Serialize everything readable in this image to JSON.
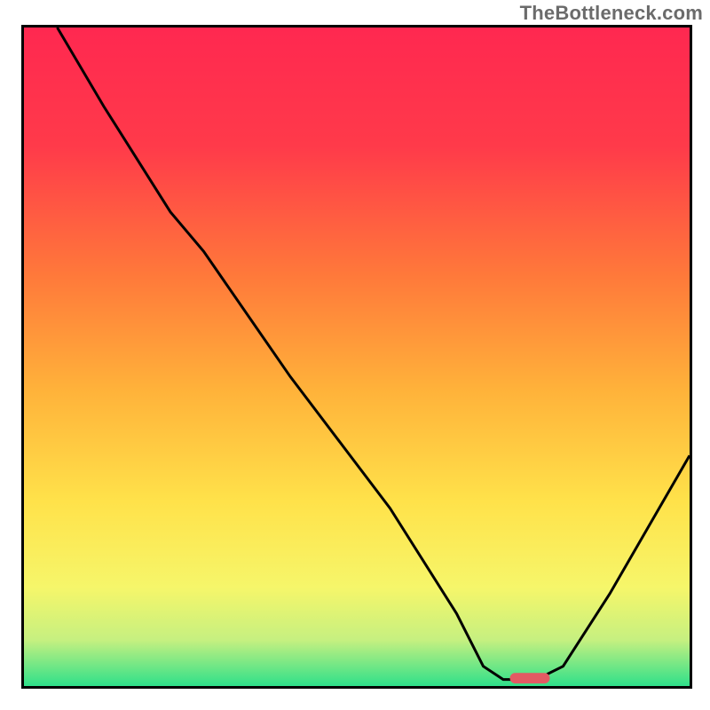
{
  "watermark": "TheBottleneck.com",
  "chart_data": {
    "type": "line",
    "title": "",
    "xlabel": "",
    "ylabel": "",
    "xlim": [
      0,
      100
    ],
    "ylim": [
      0,
      100
    ],
    "gradient_stops": [
      {
        "offset": 0,
        "color": "#ff2850"
      },
      {
        "offset": 18,
        "color": "#ff3a4a"
      },
      {
        "offset": 38,
        "color": "#ff7a3a"
      },
      {
        "offset": 55,
        "color": "#ffb23a"
      },
      {
        "offset": 72,
        "color": "#ffe24a"
      },
      {
        "offset": 85,
        "color": "#f6f66a"
      },
      {
        "offset": 93,
        "color": "#c6f080"
      },
      {
        "offset": 100,
        "color": "#2fe08a"
      }
    ],
    "series": [
      {
        "name": "curve",
        "x": [
          5,
          12,
          22,
          27,
          40,
          55,
          65,
          69,
          72,
          77,
          81,
          88,
          100
        ],
        "y": [
          100,
          88,
          72,
          66,
          47,
          27,
          11,
          3,
          1,
          1,
          3,
          14,
          35
        ]
      }
    ],
    "marker": {
      "x": 76,
      "y": 0.4,
      "width": 6,
      "height": 1.6,
      "color": "#e35a63"
    }
  }
}
